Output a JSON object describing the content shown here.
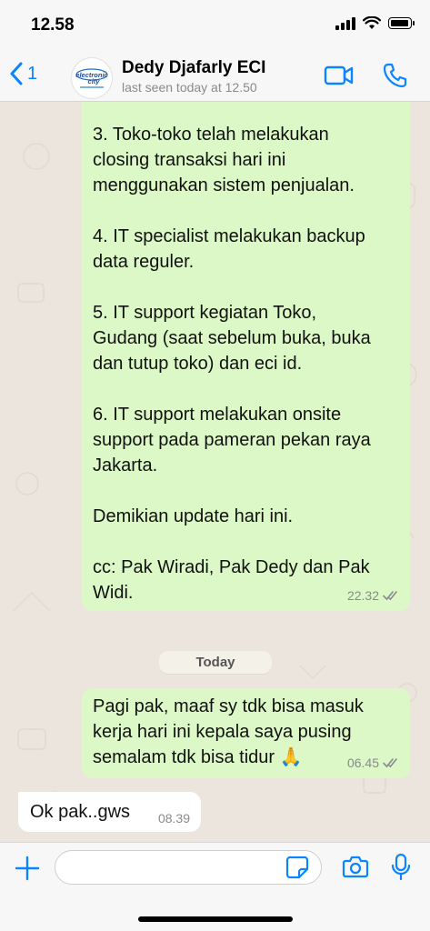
{
  "status_bar": {
    "time": "12.58"
  },
  "header": {
    "back_count": "1",
    "contact_name": "Dedy Djafarly ECI",
    "last_seen": "last seen today at 12.50",
    "avatar_logo_text": "electronic city"
  },
  "messages": [
    {
      "direction": "outgoing",
      "text": "3. Toko-toko telah melakukan\nclosing transaksi hari ini\nmenggunakan sistem penjualan.\n\n4. IT specialist melakukan backup\ndata reguler.\n\n5. IT support kegiatan Toko,\nGudang (saat sebelum buka, buka\ndan tutup toko) dan eci id.\n\n6. IT support melakukan onsite\nsupport pada pameran pekan raya\nJakarta.\n\nDemikian update hari ini.\n\ncc: Pak Wiradi, Pak Dedy dan Pak\nWidi.",
      "time": "22.32",
      "status": "read"
    },
    {
      "type": "day_separator",
      "label": "Today"
    },
    {
      "direction": "outgoing",
      "text": "Pagi pak, maaf sy tdk bisa masuk\nkerja hari ini kepala saya pusing\nsemalam tdk bisa tidur 🙏",
      "time": "06.45",
      "status": "read"
    },
    {
      "direction": "incoming",
      "text": "Ok pak..gws",
      "time": "08.39"
    }
  ],
  "input": {
    "placeholder": "",
    "value": ""
  },
  "colors": {
    "accent": "#0a84ff",
    "outgoing_bubble": "#dcf8c6",
    "incoming_bubble": "#ffffff",
    "chat_background": "#ece5dd"
  },
  "icons": [
    "back-chevron-icon",
    "video-camera-icon",
    "phone-icon",
    "plus-icon",
    "sticker-icon",
    "camera-icon",
    "microphone-icon",
    "double-check-icon"
  ]
}
